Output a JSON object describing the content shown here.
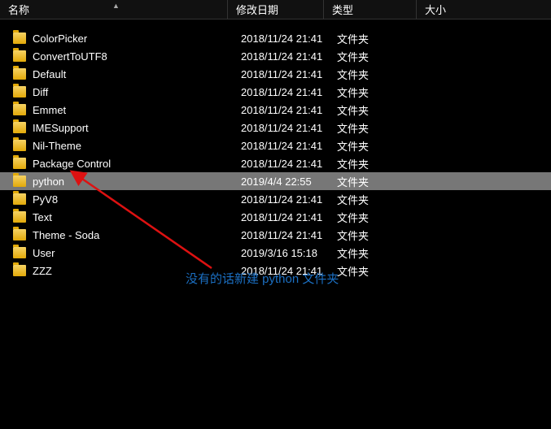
{
  "columns": {
    "name": "名称",
    "date": "修改日期",
    "type": "类型",
    "size": "大小"
  },
  "sort_indicator": "▲",
  "type_label": "文件夹",
  "rows": [
    {
      "name": "ColorPicker",
      "date": "2018/11/24 21:41",
      "selected": false
    },
    {
      "name": "ConvertToUTF8",
      "date": "2018/11/24 21:41",
      "selected": false
    },
    {
      "name": "Default",
      "date": "2018/11/24 21:41",
      "selected": false
    },
    {
      "name": "Diff",
      "date": "2018/11/24 21:41",
      "selected": false
    },
    {
      "name": "Emmet",
      "date": "2018/11/24 21:41",
      "selected": false
    },
    {
      "name": "IMESupport",
      "date": "2018/11/24 21:41",
      "selected": false
    },
    {
      "name": "Nil-Theme",
      "date": "2018/11/24 21:41",
      "selected": false
    },
    {
      "name": "Package Control",
      "date": "2018/11/24 21:41",
      "selected": false
    },
    {
      "name": "python",
      "date": "2019/4/4 22:55",
      "selected": true
    },
    {
      "name": "PyV8",
      "date": "2018/11/24 21:41",
      "selected": false
    },
    {
      "name": "Text",
      "date": "2018/11/24 21:41",
      "selected": false
    },
    {
      "name": "Theme - Soda",
      "date": "2018/11/24 21:41",
      "selected": false
    },
    {
      "name": "User",
      "date": "2019/3/16 15:18",
      "selected": false
    },
    {
      "name": "ZZZ",
      "date": "2018/11/24 21:41",
      "selected": false
    }
  ],
  "annotation": {
    "text": "没有的话新建 python 文件夹",
    "arrow_color": "#d11"
  }
}
